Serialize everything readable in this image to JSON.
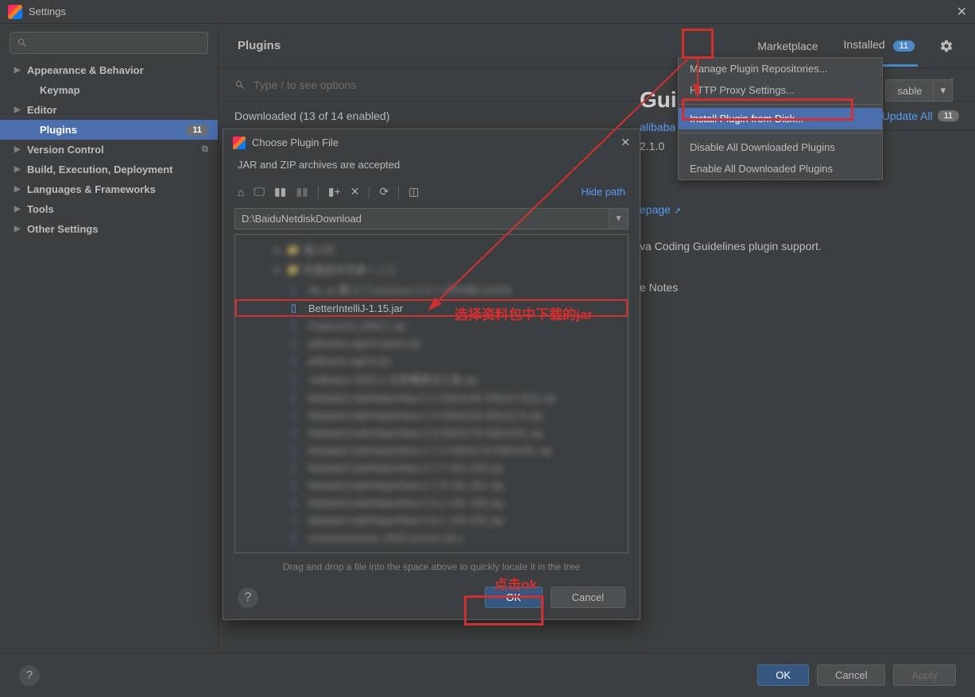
{
  "window": {
    "title": "Settings"
  },
  "sidebar": {
    "search_placeholder": "",
    "items": [
      {
        "label": "Appearance & Behavior",
        "bold": true,
        "arrow": true
      },
      {
        "label": "Keymap",
        "bold": true,
        "arrow": false,
        "sub": true
      },
      {
        "label": "Editor",
        "bold": true,
        "arrow": true
      },
      {
        "label": "Plugins",
        "bold": true,
        "arrow": false,
        "sub": true,
        "selected": true,
        "badge": "11"
      },
      {
        "label": "Version Control",
        "bold": true,
        "arrow": true,
        "icon": "⧉"
      },
      {
        "label": "Build, Execution, Deployment",
        "bold": true,
        "arrow": true
      },
      {
        "label": "Languages & Frameworks",
        "bold": true,
        "arrow": true
      },
      {
        "label": "Tools",
        "bold": true,
        "arrow": true
      },
      {
        "label": "Other Settings",
        "bold": true,
        "arrow": true
      }
    ]
  },
  "header": {
    "title": "Plugins",
    "tabs": {
      "marketplace": "Marketplace",
      "installed": "Installed",
      "installed_badge": "11"
    },
    "search_placeholder": "Type / to see options",
    "downloaded_label": "Downloaded (13 of 14 enabled)",
    "update_all": "Update All",
    "update_badge": "11",
    "disable_label": "sable"
  },
  "gear_menu": {
    "items": [
      "Manage Plugin Repositories...",
      "HTTP Proxy Settings...",
      "Install Plugin from Disk...",
      "Disable All Downloaded Plugins",
      "Enable All Downloaded Plugins"
    ],
    "selected_index": 2
  },
  "detail": {
    "title": "Guidelines",
    "vendor": "alibaba",
    "version": "2.1.0",
    "homepage": "epage",
    "desc": "va Coding Guidelines plugin support.",
    "notes": "e Notes"
  },
  "dialog": {
    "title": "Choose Plugin File",
    "subtitle": "JAR and ZIP archives are accepted",
    "hide_path": "Hide path",
    "path": "D:\\BaiduNetdiskDownload",
    "selected_file": "BetterIntelliJ-1.15.jar",
    "hint": "Drag and drop a file into the space above to quickly locate it in the tree",
    "ok": "OK",
    "cancel": "Cancel"
  },
  "footer": {
    "ok": "OK",
    "cancel": "Cancel",
    "apply": "Apply"
  },
  "annotations": {
    "jar_text": "选择资料包中下载的jar",
    "ok_text": "点击ok"
  }
}
